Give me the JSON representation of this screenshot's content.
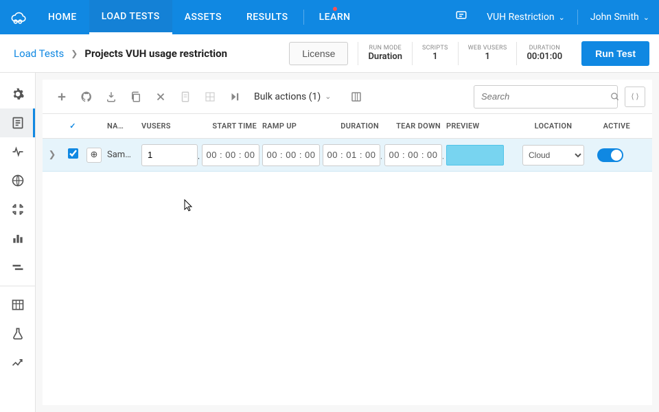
{
  "nav": {
    "home": "HOME",
    "load_tests": "LOAD TESTS",
    "assets": "ASSETS",
    "results": "RESULTS",
    "learn": "LEARN",
    "restriction": "VUH Restriction",
    "user": "John Smith"
  },
  "breadcrumb": {
    "link": "Load Tests",
    "title": "Projects VUH usage restriction"
  },
  "actions": {
    "license": "License",
    "run": "Run Test"
  },
  "stats": {
    "runmode_label": "RUN MODE",
    "runmode": "Duration",
    "scripts_label": "SCRIPTS",
    "scripts": "1",
    "webvusers_label": "WEB VUSERS",
    "webvusers": "1",
    "duration_label": "DURATION",
    "duration": "00:01:00"
  },
  "toolbar": {
    "bulk": "Bulk actions (1)",
    "search_placeholder": "Search"
  },
  "columns": {
    "name": "NA…",
    "vusers": "VUSERS",
    "start": "START TIME",
    "ramp": "RAMP UP",
    "duration": "DURATION",
    "tear": "TEAR DOWN",
    "preview": "PREVIEW",
    "location": "LOCATION",
    "active": "ACTIVE"
  },
  "row": {
    "name": "Samp…",
    "vusers": "1",
    "start": "00 : 00 : 00",
    "ramp": "00 : 00 : 00",
    "duration": "00 : 01 : 00",
    "tear": "00 : 00 : 00",
    "location": "Cloud"
  }
}
